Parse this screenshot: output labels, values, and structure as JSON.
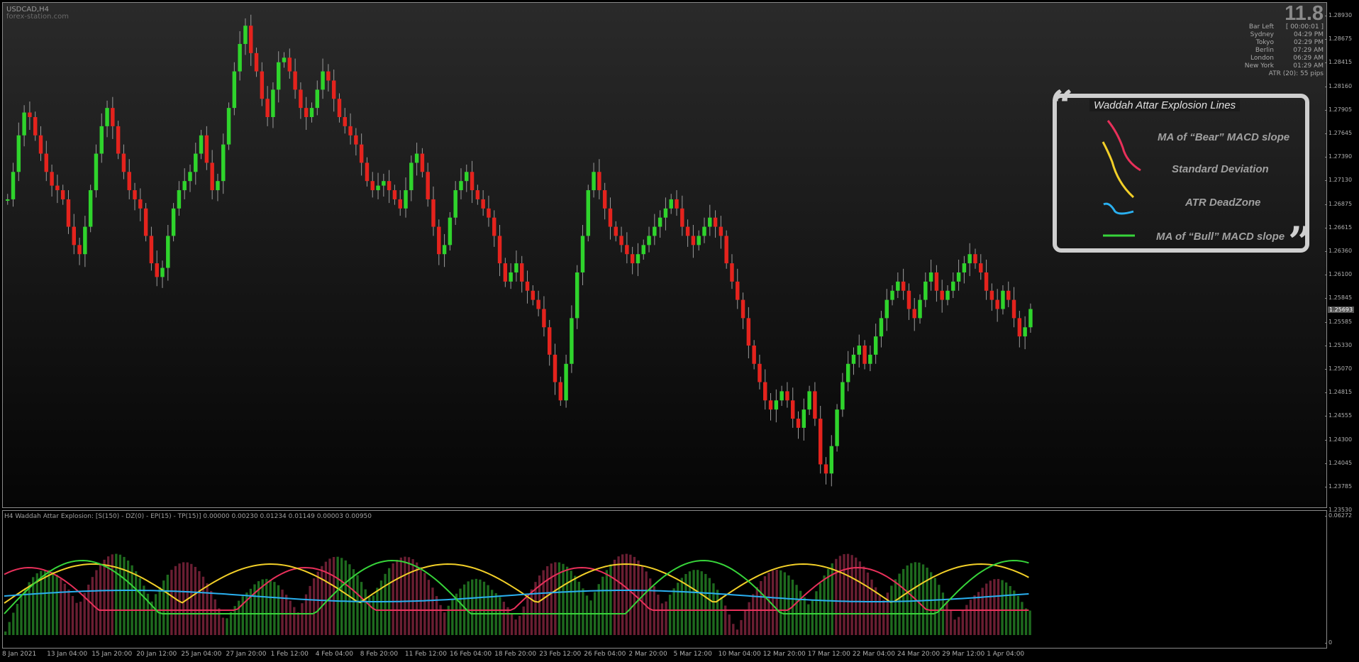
{
  "chart": {
    "symbol_title": "USDCAD,H4",
    "watermark": "forex-station.com",
    "current_price": "1.25693"
  },
  "info_panel": {
    "big_value": "11.8",
    "rows": [
      {
        "label": "Bar Left",
        "value": "[ 00:00:01 ]"
      },
      {
        "label": "Sydney",
        "value": "04:29 PM"
      },
      {
        "label": "Tokyo",
        "value": "02:29 PM"
      },
      {
        "label": "Berlin",
        "value": "07:29 AM"
      },
      {
        "label": "London",
        "value": "06:29 AM"
      },
      {
        "label": "New York",
        "value": "01:29 AM"
      }
    ],
    "atr": "ATR (20): 55 pips"
  },
  "legend": {
    "title": "Waddah Attar Explosion Lines",
    "open_quote": "“",
    "close_quote": "”",
    "items": [
      {
        "label": "MA of “Bear” MACD slope",
        "color": "#e8305a"
      },
      {
        "label": "Standard Deviation",
        "color": "#f2cf28"
      },
      {
        "label": "ATR DeadZone",
        "color": "#2ab0f0"
      },
      {
        "label": "MA of “Bull” MACD slope",
        "color": "#37d43a"
      }
    ]
  },
  "price_axis": [
    "1.28930",
    "1.28675",
    "1.28415",
    "1.28160",
    "1.27905",
    "1.27645",
    "1.27390",
    "1.27130",
    "1.26875",
    "1.26615",
    "1.26360",
    "1.26100",
    "1.25845",
    "1.25585",
    "1.25330",
    "1.25070",
    "1.24815",
    "1.24555",
    "1.24300",
    "1.24045",
    "1.23785",
    "1.23530"
  ],
  "indicator": {
    "title": "H4 Waddah Attar Explosion: [S(150) - DZ(0) - EP(15) - TP(15)] 0.00000 0.00230 0.01234 0.01149 0.00003 0.00950",
    "axis_top": "0.06272",
    "axis_bottom": "0"
  },
  "time_axis": [
    "8 Jan 2021",
    "13 Jan 04:00",
    "15 Jan 20:00",
    "20 Jan 12:00",
    "25 Jan 04:00",
    "27 Jan 20:00",
    "1 Feb 12:00",
    "4 Feb 04:00",
    "8 Feb 20:00",
    "11 Feb 12:00",
    "16 Feb 04:00",
    "18 Feb 20:00",
    "23 Feb 12:00",
    "26 Feb 04:00",
    "2 Mar 20:00",
    "5 Mar 12:00",
    "10 Mar 04:00",
    "12 Mar 20:00",
    "17 Mar 12:00",
    "22 Mar 04:00",
    "24 Mar 20:00",
    "29 Mar 12:00",
    "1 Apr 04:00"
  ],
  "chart_data": {
    "type": "candlestick",
    "ylim": [
      1.2353,
      1.2905
    ],
    "close_series": [
      1.269,
      1.272,
      1.276,
      1.2785,
      1.278,
      1.276,
      1.274,
      1.272,
      1.2705,
      1.27,
      1.269,
      1.266,
      1.264,
      1.263,
      1.266,
      1.27,
      1.274,
      1.277,
      1.279,
      1.277,
      1.274,
      1.272,
      1.27,
      1.269,
      1.268,
      1.265,
      1.262,
      1.2605,
      1.2615,
      1.265,
      1.268,
      1.27,
      1.271,
      1.272,
      1.274,
      1.276,
      1.273,
      1.27,
      1.271,
      1.275,
      1.279,
      1.283,
      1.286,
      1.288,
      1.285,
      1.283,
      1.28,
      1.278,
      1.281,
      1.284,
      1.2845,
      1.283,
      1.281,
      1.279,
      1.278,
      1.279,
      1.281,
      1.283,
      1.282,
      1.28,
      1.278,
      1.277,
      1.276,
      1.275,
      1.273,
      1.271,
      1.27,
      1.2705,
      1.271,
      1.27,
      1.269,
      1.268,
      1.27,
      1.273,
      1.274,
      1.272,
      1.269,
      1.266,
      1.263,
      1.264,
      1.267,
      1.27,
      1.271,
      1.272,
      1.27,
      1.269,
      1.268,
      1.267,
      1.265,
      1.262,
      1.26,
      1.261,
      1.262,
      1.26,
      1.259,
      1.258,
      1.257,
      1.255,
      1.252,
      1.249,
      1.247,
      1.251,
      1.256,
      1.261,
      1.265,
      1.27,
      1.272,
      1.27,
      1.268,
      1.266,
      1.265,
      1.264,
      1.263,
      1.262,
      1.263,
      1.264,
      1.265,
      1.266,
      1.267,
      1.268,
      1.269,
      1.268,
      1.266,
      1.265,
      1.264,
      1.265,
      1.266,
      1.267,
      1.266,
      1.265,
      1.262,
      1.26,
      1.258,
      1.256,
      1.253,
      1.251,
      1.249,
      1.247,
      1.246,
      1.247,
      1.248,
      1.247,
      1.245,
      1.244,
      1.246,
      1.248,
      1.245,
      1.24,
      1.239,
      1.242,
      1.246,
      1.249,
      1.251,
      1.252,
      1.253,
      1.251,
      1.252,
      1.254,
      1.256,
      1.258,
      1.259,
      1.26,
      1.259,
      1.257,
      1.256,
      1.258,
      1.26,
      1.261,
      1.259,
      1.258,
      1.259,
      1.26,
      1.261,
      1.262,
      1.263,
      1.262,
      1.261,
      1.259,
      1.258,
      1.257,
      1.259,
      1.258,
      1.256,
      1.254,
      1.255,
      1.257
    ]
  }
}
